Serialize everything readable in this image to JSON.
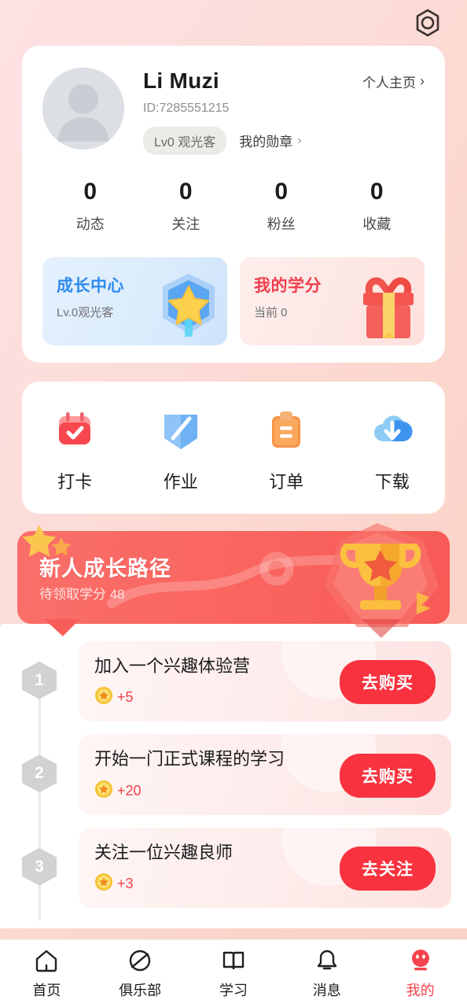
{
  "theme": {
    "accent_red": "#f8333f",
    "accent_blue": "#2f8bef",
    "bg_gradient_from": "#fde2e4",
    "bg_gradient_to": "#fad2c6"
  },
  "topbar": {
    "settings_icon": "settings-hexagon-icon"
  },
  "profile": {
    "name": "Li Muzi",
    "id": "ID:7285551215",
    "level_tag": "Lv0 观光客",
    "medal_link": "我的勋章",
    "medal_chevron": "›",
    "homepage_link": "个人主页",
    "homepage_chevron": "›",
    "avatar_icon": "default-avatar-icon"
  },
  "stats": [
    {
      "value": "0",
      "label": "动态"
    },
    {
      "value": "0",
      "label": "关注"
    },
    {
      "value": "0",
      "label": "粉丝"
    },
    {
      "value": "0",
      "label": "收藏"
    }
  ],
  "promos": [
    {
      "title": "成长中心",
      "sub": "Lv.0观光客",
      "icon": "star-shield-icon",
      "color": "#2f8bef"
    },
    {
      "title": "我的学分",
      "sub": "当前 0",
      "icon": "gift-box-icon",
      "color": "#ef3f4d"
    }
  ],
  "quick_actions": [
    {
      "label": "打卡",
      "icon": "calendar-check-icon"
    },
    {
      "label": "作业",
      "icon": "book-pen-icon"
    },
    {
      "label": "订单",
      "icon": "clipboard-list-icon"
    },
    {
      "label": "下载",
      "icon": "cloud-download-icon"
    }
  ],
  "growth_banner": {
    "title": "新人成长路径",
    "subtitle": "待领取学分 48",
    "trophy_icon": "trophy-icon",
    "star_icon": "star-sparkle-icon"
  },
  "tasks": [
    {
      "step": "1",
      "title": "加入一个兴趣体验营",
      "reward": "+5",
      "reward_icon": "coin-star-icon",
      "button": "去购买"
    },
    {
      "step": "2",
      "title": "开始一门正式课程的学习",
      "reward": "+20",
      "reward_icon": "coin-star-icon",
      "button": "去购买"
    },
    {
      "step": "3",
      "title": "关注一位兴趣良师",
      "reward": "+3",
      "reward_icon": "coin-star-icon",
      "button": "去关注"
    }
  ],
  "tabbar": [
    {
      "label": "首页",
      "icon": "home-icon",
      "active": false
    },
    {
      "label": "俱乐部",
      "icon": "planet-icon",
      "active": false
    },
    {
      "label": "学习",
      "icon": "open-book-icon",
      "active": false
    },
    {
      "label": "消息",
      "icon": "bell-icon",
      "active": false
    },
    {
      "label": "我的",
      "icon": "smiley-face-icon",
      "active": true
    }
  ]
}
